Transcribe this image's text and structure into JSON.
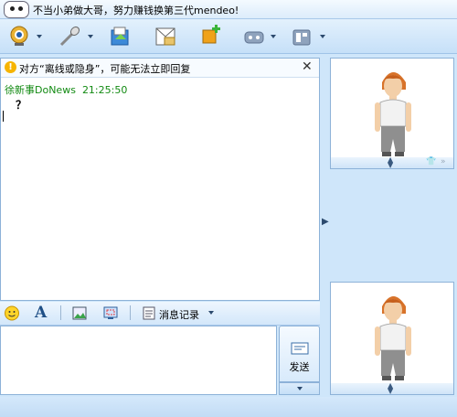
{
  "window": {
    "title": "不当小弟做大哥，努力赚钱换第三代mendeo!"
  },
  "toolbar": {
    "buttons": [
      {
        "name": "video-call",
        "icon": "webcam-icon"
      },
      {
        "name": "voice-call",
        "icon": "microphone-icon"
      },
      {
        "name": "send-file",
        "icon": "send-file-icon"
      },
      {
        "name": "send-mail",
        "icon": "email-icon"
      },
      {
        "name": "invite",
        "icon": "add-contact-icon"
      },
      {
        "name": "games",
        "icon": "gamepad-icon"
      },
      {
        "name": "apps",
        "icon": "apps-icon"
      }
    ]
  },
  "notice": {
    "text": "对方“离线或隐身”，可能无法立即回复"
  },
  "messages": [
    {
      "sender": "徐新事DoNews",
      "time": "21:25:50",
      "body": "？"
    }
  ],
  "formatbar": {
    "history_label": "消息记录"
  },
  "send": {
    "label": "发送"
  },
  "colors": {
    "window_bg": "#cfe6fa",
    "sender_name": "#128a12",
    "border": "#8db2d8"
  }
}
